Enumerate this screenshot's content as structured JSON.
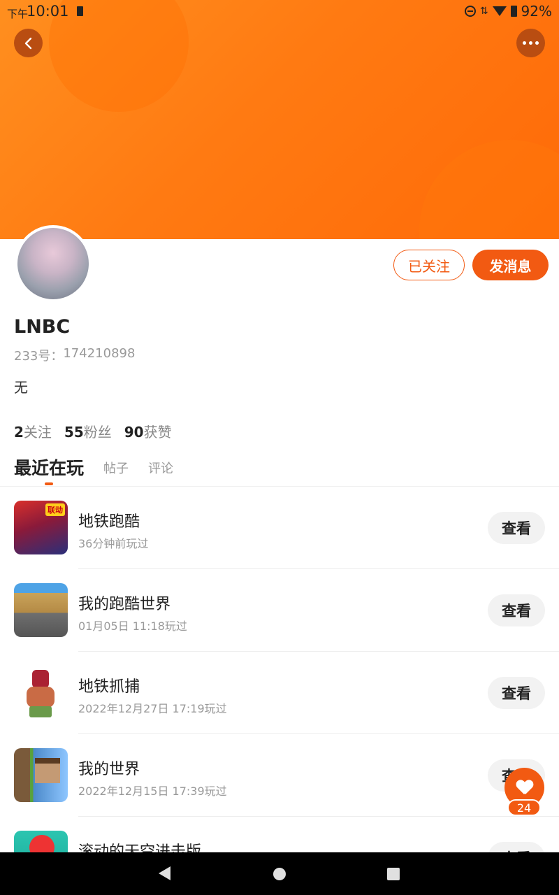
{
  "status_bar": {
    "time_prefix": "下午",
    "time": "10:01",
    "battery": "92%"
  },
  "profile": {
    "username": "LNBC",
    "id_label": "233号：",
    "id_value": "174210898",
    "bio": "无",
    "followed_label": "已关注",
    "message_label": "发消息"
  },
  "stats": [
    {
      "count": "2",
      "label": "关注"
    },
    {
      "count": "55",
      "label": "粉丝"
    },
    {
      "count": "90",
      "label": "获赞"
    }
  ],
  "tabs": {
    "active": "最近在玩",
    "posts": "帖子",
    "comments": "评论"
  },
  "games": [
    {
      "name": "地铁跑酷",
      "time": "36分钟前玩过",
      "action": "查看",
      "icon": "subway-surfers-icon"
    },
    {
      "name": "我的跑酷世界",
      "time": "01月05日 11:18玩过",
      "action": "查看",
      "icon": "parkour-world-icon"
    },
    {
      "name": "地铁抓捕",
      "time": "2022年12月27日 17:19玩过",
      "action": "查看",
      "icon": "subway-catch-icon"
    },
    {
      "name": "我的世界",
      "time": "2022年12月15日 17:39玩过",
      "action": "查看",
      "icon": "minecraft-icon"
    },
    {
      "name": "滚动的天空进击版",
      "time": "",
      "action": "查看",
      "icon": "rolling-sky-icon"
    }
  ],
  "like_widget": {
    "count": "24"
  },
  "colors": {
    "accent": "#f25a12",
    "banner": "#ff7a12"
  }
}
